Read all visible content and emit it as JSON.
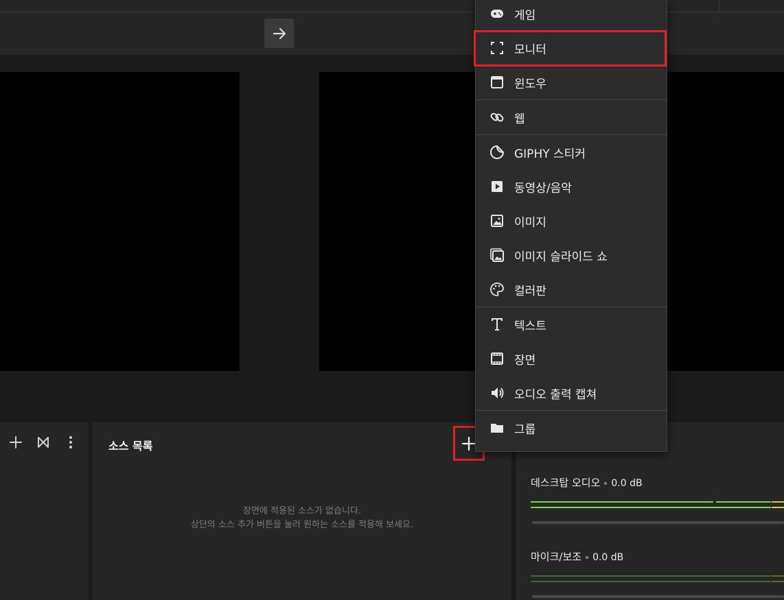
{
  "menu": {
    "items": [
      {
        "label": "게임",
        "icon": "gamepad-icon"
      },
      {
        "label": "모니터",
        "icon": "monitor-icon"
      },
      {
        "label": "윈도우",
        "icon": "window-icon"
      },
      {
        "label": "웹",
        "icon": "link-icon"
      },
      {
        "label": "GIPHY 스티커",
        "icon": "sticker-icon"
      },
      {
        "label": "동영상/음악",
        "icon": "play-icon"
      },
      {
        "label": "이미지",
        "icon": "image-icon"
      },
      {
        "label": "이미지 슬라이드 쇼",
        "icon": "slideshow-icon"
      },
      {
        "label": "컬러판",
        "icon": "palette-icon"
      },
      {
        "label": "텍스트",
        "icon": "text-icon"
      },
      {
        "label": "장면",
        "icon": "film-icon"
      },
      {
        "label": "오디오 출력 캡쳐",
        "icon": "speaker-icon"
      },
      {
        "label": "그룹",
        "icon": "folder-icon"
      }
    ]
  },
  "sources": {
    "title": "소스 목록",
    "empty_line1": "장면에 적용된 소스가 없습니다.",
    "empty_line2": "상단의 소스 추가 버튼을 눌러 원하는 소스를 적용해 보세요."
  },
  "mixer": {
    "desktop_label": "데스크탑 오디오",
    "desktop_db": "0.0 dB",
    "mic_label": "마이크/보조",
    "mic_db": "0.0 dB"
  },
  "colors": {
    "highlight": "#e0202a",
    "meter_green": "#7cd455",
    "meter_yellow": "#d6c94a"
  }
}
